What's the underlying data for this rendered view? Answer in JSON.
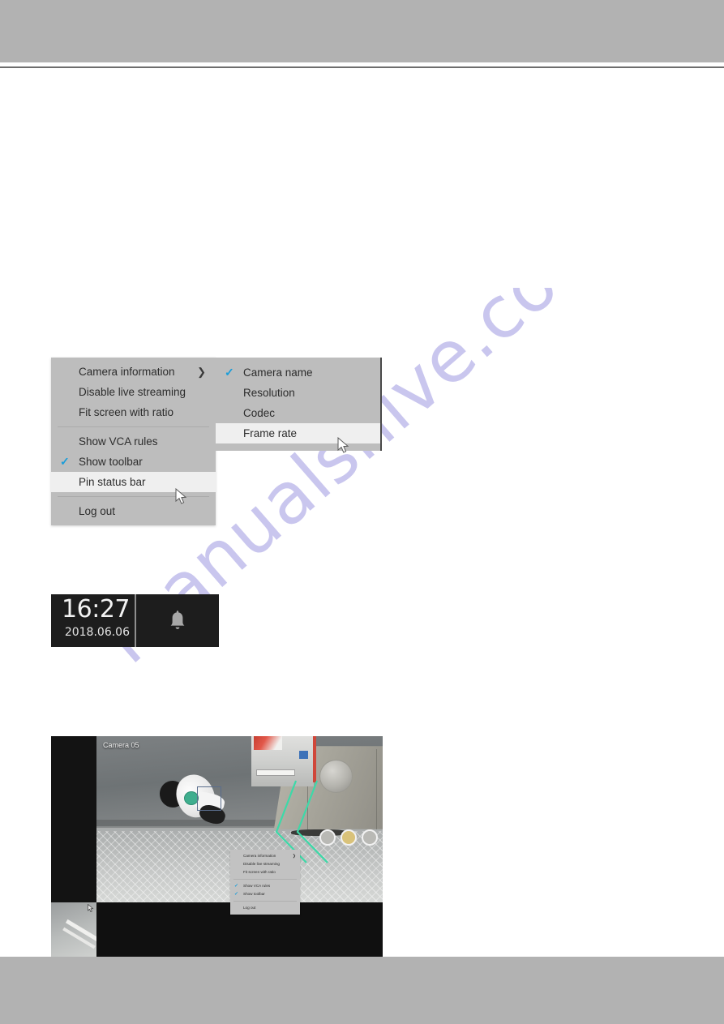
{
  "page": {
    "header_band_color": "#b2b2b2",
    "footer_band_color": "#b2b2b2",
    "watermark": "manualshive.com",
    "watermark_color": "#c9c6ee"
  },
  "context_menu": {
    "groups": [
      {
        "items": [
          {
            "label": "Camera information",
            "checked": false,
            "has_submenu": true,
            "submenu_icon": "chevron-right-icon",
            "hovered": false
          },
          {
            "label": "Disable live streaming",
            "checked": false,
            "has_submenu": false,
            "hovered": false
          },
          {
            "label": "Fit screen with ratio",
            "checked": false,
            "has_submenu": false,
            "hovered": false
          }
        ]
      },
      {
        "items": [
          {
            "label": "Show VCA rules",
            "checked": false,
            "has_submenu": false,
            "hovered": false
          },
          {
            "label": "Show toolbar",
            "checked": true,
            "has_submenu": false,
            "hovered": false
          },
          {
            "label": "Pin status bar",
            "checked": false,
            "has_submenu": false,
            "hovered": true
          }
        ]
      },
      {
        "items": [
          {
            "label": "Log out",
            "checked": false,
            "has_submenu": false,
            "hovered": false
          }
        ]
      }
    ],
    "check_color": "#1b9dd9",
    "background": "#bdbdbd",
    "hover_background": "#efefef"
  },
  "submenu": {
    "title": "Camera information",
    "items": [
      {
        "label": "Camera name",
        "checked": true,
        "hovered": false
      },
      {
        "label": "Resolution",
        "checked": false,
        "hovered": false
      },
      {
        "label": "Codec",
        "checked": false,
        "hovered": false
      },
      {
        "label": "Frame rate",
        "checked": false,
        "hovered": true
      }
    ]
  },
  "status_bar": {
    "time": "16:27",
    "date": "2018.06.06",
    "alarm_icon": "bell-icon",
    "background": "#1d1d1d"
  },
  "camera_panel": {
    "camera_label": "Camera 05",
    "vca_rule_color": "#3dd9a8",
    "overlay_menu": {
      "groups": [
        {
          "items": [
            {
              "label": "Camera information",
              "checked": false,
              "has_submenu": true
            },
            {
              "label": "Disable live streaming",
              "checked": false,
              "has_submenu": false
            },
            {
              "label": "Fit screen with ratio",
              "checked": false,
              "has_submenu": false
            }
          ]
        },
        {
          "items": [
            {
              "label": "Show VCA rules",
              "checked": true,
              "has_submenu": false
            },
            {
              "label": "Show toolbar",
              "checked": true,
              "has_submenu": false
            }
          ]
        },
        {
          "items": [
            {
              "label": "Log out",
              "checked": false,
              "has_submenu": false
            }
          ]
        }
      ]
    }
  }
}
